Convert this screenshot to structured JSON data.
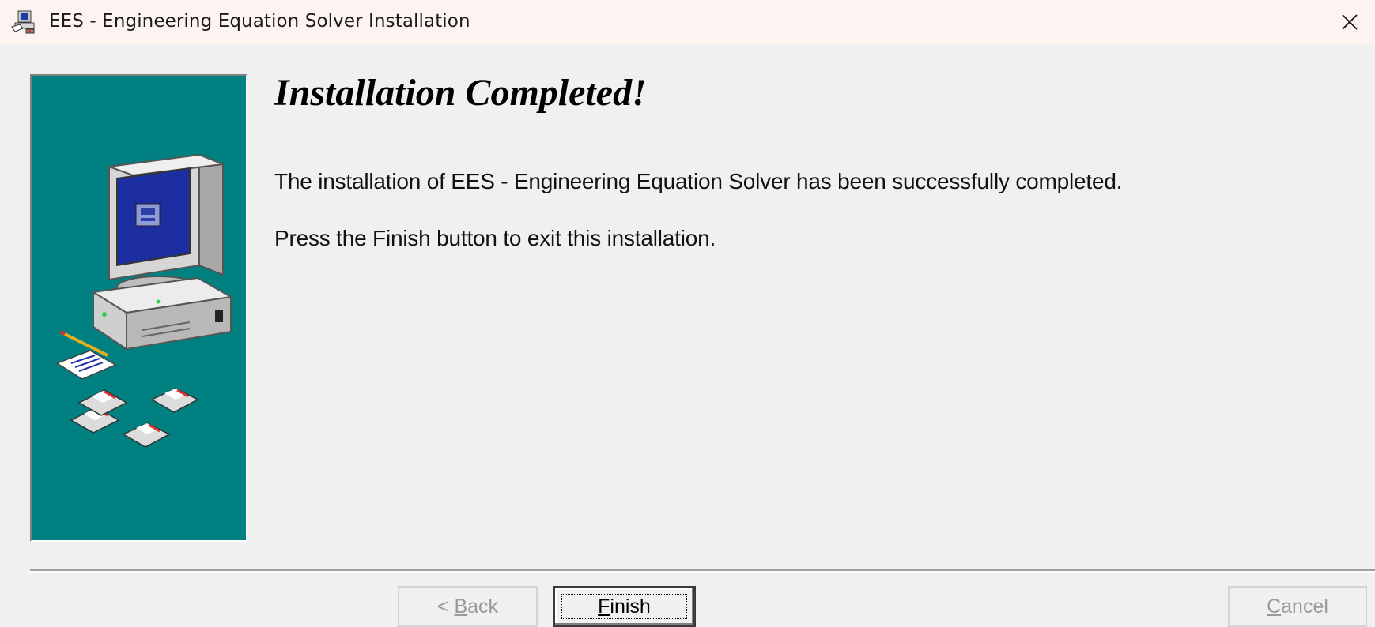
{
  "window": {
    "title": "EES - Engineering Equation Solver Installation",
    "close_icon": "close-icon"
  },
  "content": {
    "heading": "Installation Completed!",
    "message_line1": "The installation of EES - Engineering Equation Solver has been successfully completed.",
    "message_line2": "Press the Finish button to exit this installation."
  },
  "buttons": {
    "back_prefix": "< ",
    "back_mnemonic": "B",
    "back_rest": "ack",
    "finish_mnemonic": "F",
    "finish_rest": "inish",
    "cancel_mnemonic": "C",
    "cancel_rest": "ancel"
  },
  "colors": {
    "side_panel": "#008080",
    "background": "#f0f0f0",
    "titlebar": "#fdf3f1"
  }
}
